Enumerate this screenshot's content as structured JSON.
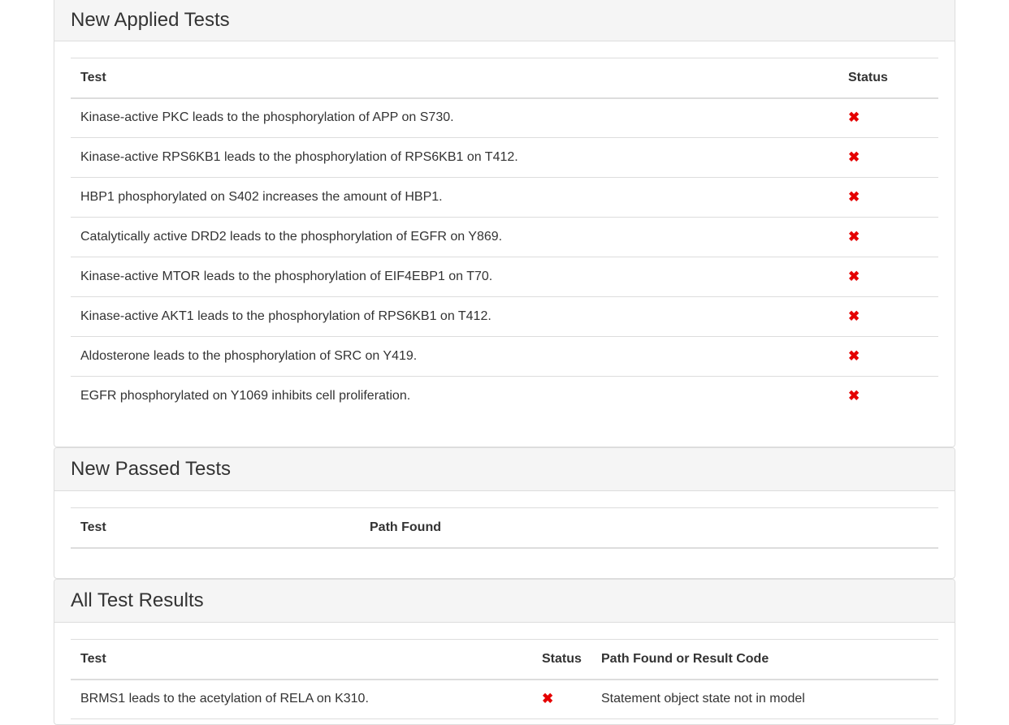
{
  "applied": {
    "title": "New Applied Tests",
    "headers": [
      "Test",
      "Status"
    ],
    "rows": [
      {
        "test": "Kinase-active PKC leads to the phosphorylation of APP on S730.",
        "status": "✖"
      },
      {
        "test": "Kinase-active RPS6KB1 leads to the phosphorylation of RPS6KB1 on T412.",
        "status": "✖"
      },
      {
        "test": "HBP1 phosphorylated on S402 increases the amount of HBP1.",
        "status": "✖"
      },
      {
        "test": "Catalytically active DRD2 leads to the phosphorylation of EGFR on Y869.",
        "status": "✖"
      },
      {
        "test": "Kinase-active MTOR leads to the phosphorylation of EIF4EBP1 on T70.",
        "status": "✖"
      },
      {
        "test": "Kinase-active AKT1 leads to the phosphorylation of RPS6KB1 on T412.",
        "status": "✖"
      },
      {
        "test": "Aldosterone leads to the phosphorylation of SRC on Y419.",
        "status": "✖"
      },
      {
        "test": "EGFR phosphorylated on Y1069 inhibits cell proliferation.",
        "status": "✖"
      }
    ]
  },
  "passed": {
    "title": "New Passed Tests",
    "headers": [
      "Test",
      "Path Found"
    ]
  },
  "all": {
    "title": "All Test Results",
    "headers": [
      "Test",
      "Status",
      "Path Found or Result Code"
    ],
    "rows": [
      {
        "test": "BRMS1 leads to the acetylation of RELA on K310.",
        "status": "✖",
        "result": "Statement object state not in model"
      }
    ]
  },
  "colors": {
    "fail": "#e50000",
    "heading_bg": "#f5f5f5",
    "border": "#dddddd"
  },
  "icons": {
    "fail": "x-icon"
  }
}
